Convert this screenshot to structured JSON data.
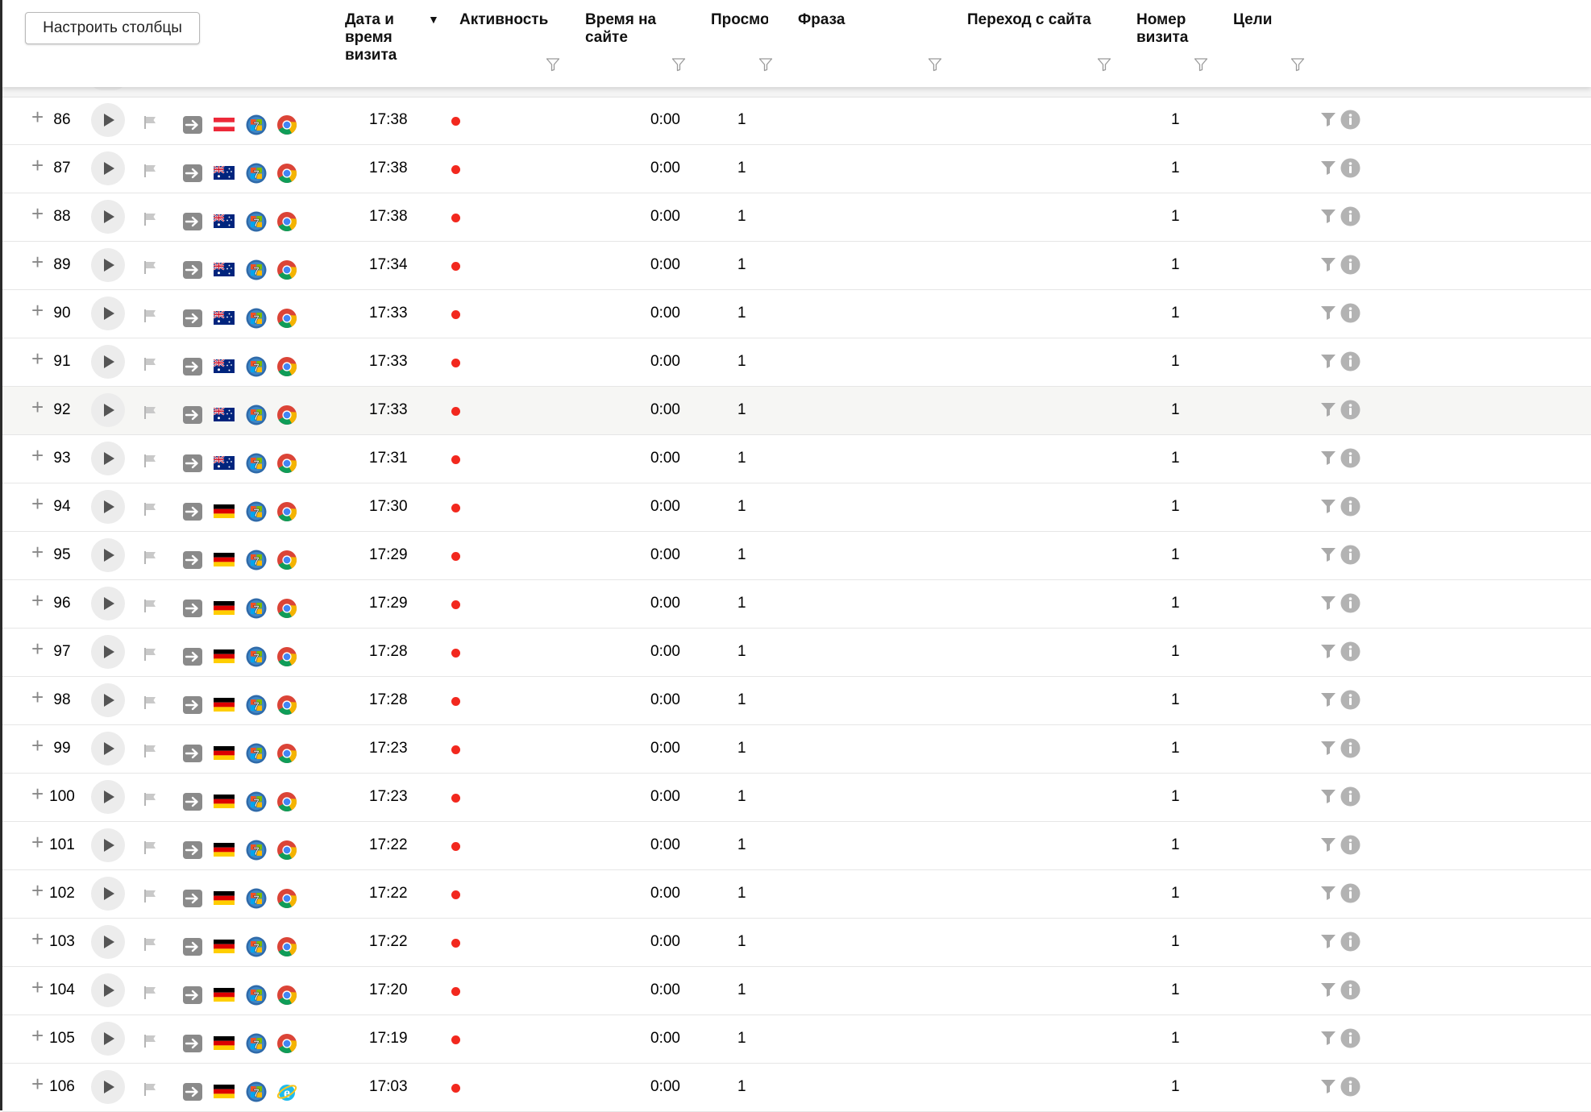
{
  "toolbar": {
    "configure_columns": "Настроить столбцы"
  },
  "columns": [
    {
      "key": "datetime",
      "label": "Дата и\nвремя\nвизита",
      "sorted": "desc"
    },
    {
      "key": "activity",
      "label": "Активность"
    },
    {
      "key": "time_on_site",
      "label": "Время на\nсайте"
    },
    {
      "key": "views",
      "label": "Просмотры"
    },
    {
      "key": "phrase",
      "label": "Фраза"
    },
    {
      "key": "referrer",
      "label": "Переход с сайта"
    },
    {
      "key": "visit_number",
      "label": "Номер\nвизита"
    },
    {
      "key": "goals",
      "label": "Цели"
    }
  ],
  "colors": {
    "activity_dot": "#f2281e",
    "row_highlight": "#f6f6f4"
  },
  "icons": {
    "row": [
      "plus-icon",
      "play-icon",
      "flag-icon",
      "source-direct-icon",
      "country-flag-icon",
      "os-windows-7-icon",
      "browser-icon",
      "filter-icon",
      "info-icon"
    ]
  },
  "rows": [
    {
      "n": "86",
      "country": "austria",
      "browser": "chrome",
      "time": "17:38",
      "duration": "0:00",
      "views": "1",
      "visit_number": "1"
    },
    {
      "n": "87",
      "country": "australia",
      "browser": "chrome",
      "time": "17:38",
      "duration": "0:00",
      "views": "1",
      "visit_number": "1"
    },
    {
      "n": "88",
      "country": "australia",
      "browser": "chrome",
      "time": "17:38",
      "duration": "0:00",
      "views": "1",
      "visit_number": "1"
    },
    {
      "n": "89",
      "country": "australia",
      "browser": "chrome",
      "time": "17:34",
      "duration": "0:00",
      "views": "1",
      "visit_number": "1"
    },
    {
      "n": "90",
      "country": "australia",
      "browser": "chrome",
      "time": "17:33",
      "duration": "0:00",
      "views": "1",
      "visit_number": "1"
    },
    {
      "n": "91",
      "country": "australia",
      "browser": "chrome",
      "time": "17:33",
      "duration": "0:00",
      "views": "1",
      "visit_number": "1"
    },
    {
      "n": "92",
      "country": "australia",
      "browser": "chrome",
      "time": "17:33",
      "duration": "0:00",
      "views": "1",
      "visit_number": "1",
      "highlight": true
    },
    {
      "n": "93",
      "country": "australia",
      "browser": "chrome",
      "time": "17:31",
      "duration": "0:00",
      "views": "1",
      "visit_number": "1"
    },
    {
      "n": "94",
      "country": "germany",
      "browser": "chrome",
      "time": "17:30",
      "duration": "0:00",
      "views": "1",
      "visit_number": "1"
    },
    {
      "n": "95",
      "country": "germany",
      "browser": "chrome",
      "time": "17:29",
      "duration": "0:00",
      "views": "1",
      "visit_number": "1"
    },
    {
      "n": "96",
      "country": "germany",
      "browser": "chrome",
      "time": "17:29",
      "duration": "0:00",
      "views": "1",
      "visit_number": "1"
    },
    {
      "n": "97",
      "country": "germany",
      "browser": "chrome",
      "time": "17:28",
      "duration": "0:00",
      "views": "1",
      "visit_number": "1"
    },
    {
      "n": "98",
      "country": "germany",
      "browser": "chrome",
      "time": "17:28",
      "duration": "0:00",
      "views": "1",
      "visit_number": "1"
    },
    {
      "n": "99",
      "country": "germany",
      "browser": "chrome",
      "time": "17:23",
      "duration": "0:00",
      "views": "1",
      "visit_number": "1"
    },
    {
      "n": "100",
      "country": "germany",
      "browser": "chrome",
      "time": "17:23",
      "duration": "0:00",
      "views": "1",
      "visit_number": "1"
    },
    {
      "n": "101",
      "country": "germany",
      "browser": "chrome",
      "time": "17:22",
      "duration": "0:00",
      "views": "1",
      "visit_number": "1"
    },
    {
      "n": "102",
      "country": "germany",
      "browser": "chrome",
      "time": "17:22",
      "duration": "0:00",
      "views": "1",
      "visit_number": "1"
    },
    {
      "n": "103",
      "country": "germany",
      "browser": "chrome",
      "time": "17:22",
      "duration": "0:00",
      "views": "1",
      "visit_number": "1"
    },
    {
      "n": "104",
      "country": "germany",
      "browser": "chrome",
      "time": "17:20",
      "duration": "0:00",
      "views": "1",
      "visit_number": "1"
    },
    {
      "n": "105",
      "country": "germany",
      "browser": "chrome",
      "time": "17:19",
      "duration": "0:00",
      "views": "1",
      "visit_number": "1"
    },
    {
      "n": "106",
      "country": "germany",
      "browser": "internet-explorer",
      "time": "17:03",
      "duration": "0:00",
      "views": "1",
      "visit_number": "1"
    }
  ]
}
